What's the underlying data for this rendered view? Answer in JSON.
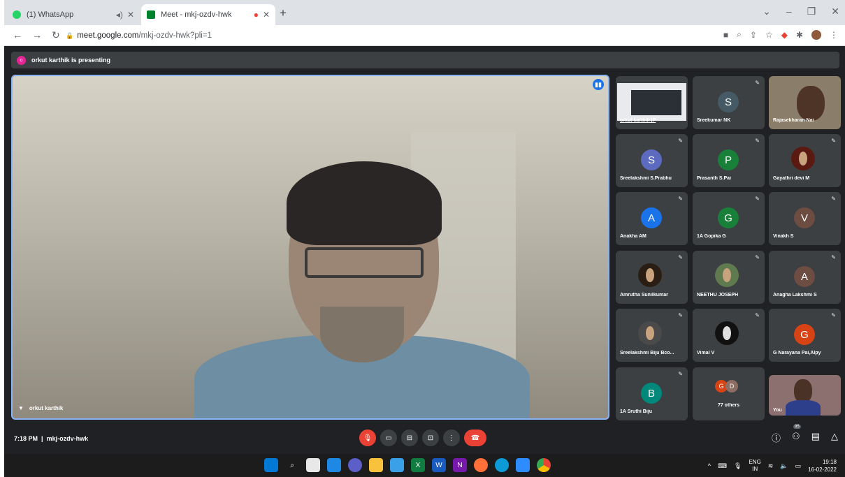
{
  "browser": {
    "tabs": [
      {
        "label": "(1) WhatsApp",
        "favicon_color": "#25d366"
      },
      {
        "label": "Meet - mkj-ozdv-hwk",
        "favicon_color": "#00832d"
      }
    ],
    "new_tab": "+",
    "url_host": "meet.google.com",
    "url_path": "/mkj-ozdv-hwk?pli=1"
  },
  "meet": {
    "presenting_banner": "orkut karthik is presenting",
    "presenter_initial": "o",
    "main_speaker": "orkut karthik",
    "time": "7:18 PM",
    "meeting_code": "mkj-ozdv-hwk",
    "participants_badge": "95",
    "tiles": [
      {
        "name": "orkut karthik (P",
        "type": "screen"
      },
      {
        "name": "Sreekumar NK",
        "initial": "S",
        "color": "#455a64"
      },
      {
        "name": "Rajasekharan Nai",
        "type": "photo"
      },
      {
        "name": "Sreelakshmi S.Prabhu",
        "initial": "S",
        "color": "#5c6bc0"
      },
      {
        "name": "Prasanth S.Pai",
        "initial": "P",
        "color": "#188038"
      },
      {
        "name": "Gayathri devi M",
        "type": "photo"
      },
      {
        "name": "Anakha AM",
        "initial": "A",
        "color": "#1a73e8"
      },
      {
        "name": "1A Gopika G",
        "initial": "G",
        "color": "#188038"
      },
      {
        "name": "Vinakh S",
        "initial": "V",
        "color": "#6d4c41"
      },
      {
        "name": "Amrutha Sunilkumar",
        "type": "photo"
      },
      {
        "name": "NEETHU JOSEPH",
        "type": "photo"
      },
      {
        "name": "Anagha Lakshmi S",
        "initial": "A",
        "color": "#6d4c41"
      },
      {
        "name": "Sreelakshmi Biju Bco...",
        "type": "photo"
      },
      {
        "name": "Vimal V",
        "type": "photo"
      },
      {
        "name": "G Narayana Pai,Alpy",
        "initial": "G",
        "color": "#d84315"
      },
      {
        "name": "1A Sruthi Biju",
        "initial": "B",
        "color": "#00897b"
      },
      {
        "name": "77 others",
        "type": "others",
        "initials": [
          "G",
          "D"
        ]
      },
      {
        "name": "You",
        "type": "self"
      }
    ]
  },
  "taskbar": {
    "lang_top": "ENG",
    "lang_bottom": "IN",
    "clock_time": "19:18",
    "clock_date": "16-02-2022"
  }
}
